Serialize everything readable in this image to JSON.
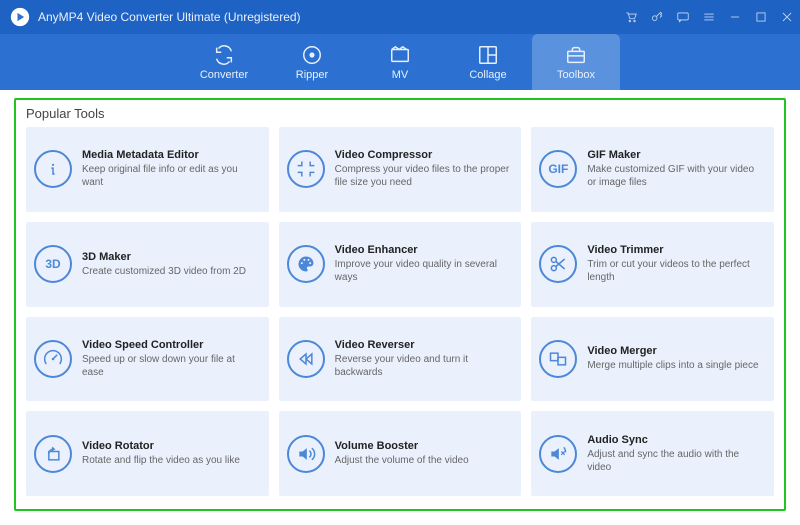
{
  "app": {
    "title": "AnyMP4 Video Converter Ultimate (Unregistered)"
  },
  "tabs": {
    "converter": "Converter",
    "ripper": "Ripper",
    "mv": "MV",
    "collage": "Collage",
    "toolbox": "Toolbox"
  },
  "panel": {
    "title": "Popular Tools"
  },
  "tools": {
    "metadata": {
      "name": "Media Metadata Editor",
      "desc": "Keep original file info or edit as you want",
      "icon_label": ""
    },
    "compressor": {
      "name": "Video Compressor",
      "desc": "Compress your video files to the proper file size you need",
      "icon_label": ""
    },
    "gif": {
      "name": "GIF Maker",
      "desc": "Make customized GIF with your video or image files",
      "icon_label": "GIF"
    },
    "maker3d": {
      "name": "3D Maker",
      "desc": "Create customized 3D video from 2D",
      "icon_label": "3D"
    },
    "enhancer": {
      "name": "Video Enhancer",
      "desc": "Improve your video quality in several ways",
      "icon_label": ""
    },
    "trimmer": {
      "name": "Video Trimmer",
      "desc": "Trim or cut your videos to the perfect length",
      "icon_label": ""
    },
    "speed": {
      "name": "Video Speed Controller",
      "desc": "Speed up or slow down your file at ease",
      "icon_label": ""
    },
    "reverser": {
      "name": "Video Reverser",
      "desc": "Reverse your video and turn it backwards",
      "icon_label": ""
    },
    "merger": {
      "name": "Video Merger",
      "desc": "Merge multiple clips into a single piece",
      "icon_label": ""
    },
    "rotator": {
      "name": "Video Rotator",
      "desc": "Rotate and flip the video as you like",
      "icon_label": ""
    },
    "volume": {
      "name": "Volume Booster",
      "desc": "Adjust the volume of the video",
      "icon_label": ""
    },
    "sync": {
      "name": "Audio Sync",
      "desc": "Adjust and sync the audio with the video",
      "icon_label": ""
    }
  }
}
